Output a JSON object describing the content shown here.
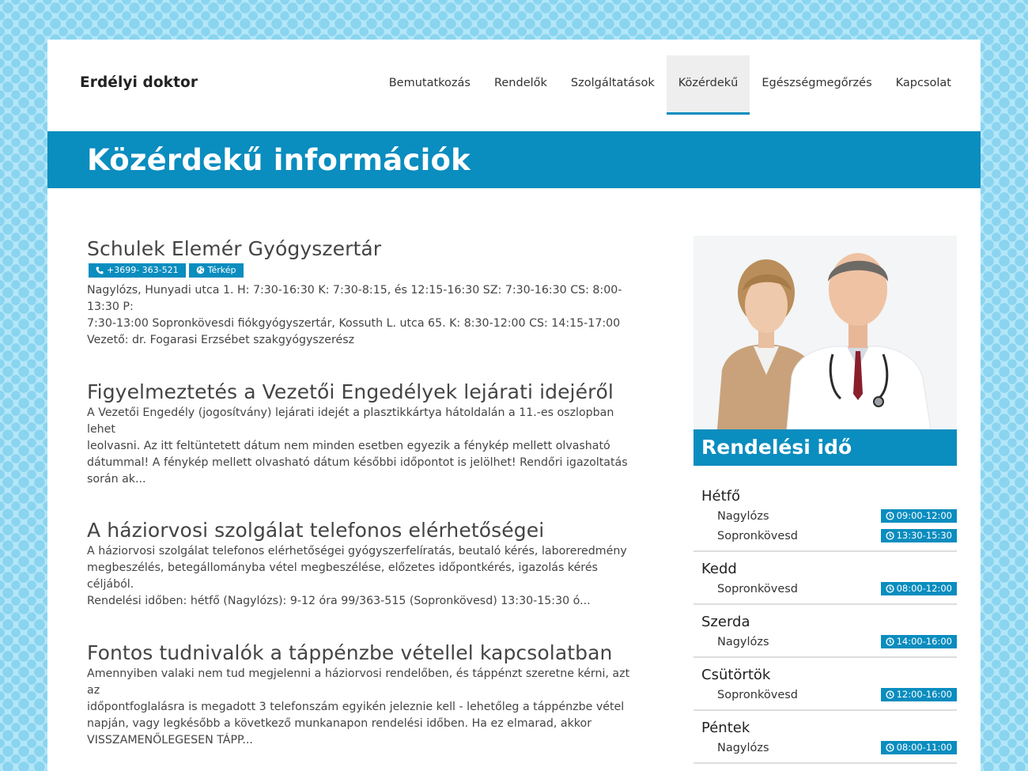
{
  "header": {
    "brand": "Erdélyi doktor",
    "nav": [
      {
        "label": "Bemutatkozás",
        "active": false
      },
      {
        "label": "Rendelők",
        "active": false
      },
      {
        "label": "Szolgáltatások",
        "active": false
      },
      {
        "label": "Közérdekű",
        "active": true
      },
      {
        "label": "Egészségmegőrzés",
        "active": false
      },
      {
        "label": "Kapcsolat",
        "active": false
      }
    ]
  },
  "hero": {
    "title": "Közérdekű információk"
  },
  "articles": [
    {
      "title": "Schulek Elemér Gyógyszertár",
      "phone": "+3699- 363-521",
      "map_label": "Térkép",
      "lines": [
        "Nagylózs, Hunyadi utca 1. H: 7:30-16:30 K: 7:30-8:15, és 12:15-16:30 SZ: 7:30-16:30 CS: 8:00-13:30 P:",
        "7:30-13:00 Sopronkövesdi fiókgyógyszertár, Kossuth L. utca 65. K: 8:30-12:00 CS: 14:15-17:00",
        "Vezető: dr. Fogarasi Erzsébet szakgyógyszerész"
      ]
    },
    {
      "title": "Figyelmeztetés a Vezetői Engedélyek lejárati idejéről",
      "lines": [
        "A Vezetői Engedély (jogosítvány) lejárati idejét a plasztikkártya hátoldalán a 11.-es oszlopban lehet",
        "leolvasni. Az itt feltüntetett dátum nem minden esetben egyezik a fénykép mellett olvasható",
        "dátummal! A fénykép mellett olvasható dátum későbbi időpontot is jelölhet! Rendőri igazoltatás",
        "során ak..."
      ]
    },
    {
      "title": "A háziorvosi szolgálat telefonos elérhetőségei",
      "lines": [
        "A háziorvosi szolgálat telefonos elérhetőségei gyógyszerfelíratás, beutaló kérés, laboreredmény",
        "megbeszélés, betegállományba vétel megbeszélése, előzetes időpontkérés, igazolás kérés céljából.",
        "Rendelési időben: hétfő (Nagylózs): 9-12 óra  99/363-515 (Sopronkövesd) 13:30-15:30 ó..."
      ]
    },
    {
      "title": "Fontos tudnivalók a táppénzbe vétellel kapcsolatban",
      "lines": [
        "Amennyiben valaki nem tud megjelenni a háziorvosi rendelőben, és táppénzt szeretne kérni, azt az",
        "időpontfoglalásra is megadott 3 telefonszám egyikén jeleznie kell - lehetőleg a táppénzbe vétel",
        "napján, vagy legkésőbb a következő munkanapon rendelési időben. Ha ez elmarad, akkor",
        "VISSZAMENŐLEGESEN TÁPP..."
      ]
    }
  ],
  "sidebar": {
    "title": "Rendelési idő",
    "days": [
      {
        "name": "Hétfő",
        "entries": [
          {
            "location": "Nagylózs",
            "time": "09:00-12:00"
          },
          {
            "location": "Sopronkövesd",
            "time": "13:30-15:30"
          }
        ]
      },
      {
        "name": "Kedd",
        "entries": [
          {
            "location": "Sopronkövesd",
            "time": "08:00-12:00"
          }
        ]
      },
      {
        "name": "Szerda",
        "entries": [
          {
            "location": "Nagylózs",
            "time": "14:00-16:00"
          }
        ]
      },
      {
        "name": "Csütörtök",
        "entries": [
          {
            "location": "Sopronkövesd",
            "time": "12:00-16:00"
          }
        ]
      },
      {
        "name": "Péntek",
        "entries": [
          {
            "location": "Nagylózs",
            "time": "08:00-11:00"
          }
        ]
      }
    ]
  },
  "colors": {
    "accent": "#0a8dbf",
    "background_dots": "#8ad4f0",
    "background": "#b3e6f7"
  },
  "icons": [
    "phone-icon",
    "globe-icon",
    "clock-icon"
  ]
}
